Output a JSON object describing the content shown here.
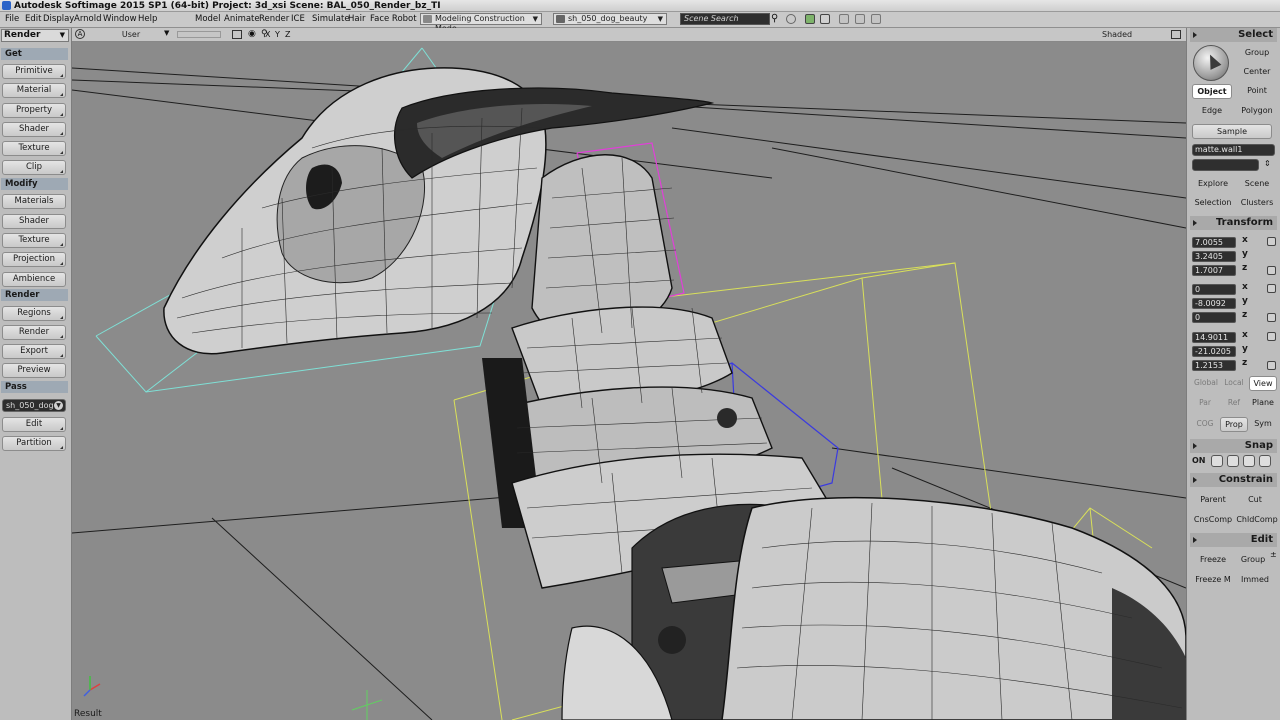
{
  "title": "Autodesk Softimage 2015 SP1 (64-bit)    Project: 3d_xsi    Scene: BAL_050_Render_bz_TI",
  "menus": [
    "File",
    "Edit",
    "Display",
    "Arnold",
    "Window",
    "Help",
    "Model",
    "Animate",
    "Render",
    "ICE",
    "Simulate",
    "Hair",
    "Face Robot"
  ],
  "mode_combo": "Modeling Construction Mode",
  "pass_combo": "sh_050_dog_beauty",
  "search_placeholder": "Scene Search",
  "left": {
    "render_mode": "Render",
    "sections": {
      "get": "Get",
      "modify": "Modify",
      "render": "Render",
      "pass": "Pass"
    },
    "get_buttons": [
      "Primitive",
      "Material",
      "Property",
      "Shader",
      "Texture",
      "Clip"
    ],
    "modify_buttons": [
      "Materials",
      "Shader",
      "Texture",
      "Projection",
      "Ambience"
    ],
    "render_buttons": [
      "Regions",
      "Render",
      "Export",
      "Preview"
    ],
    "pass_field": "sh_050_dog",
    "pass_buttons": [
      "Edit",
      "Partition"
    ]
  },
  "viewport": {
    "camera": "User",
    "axes": [
      "X",
      "Y",
      "Z"
    ],
    "shading": "Shaded",
    "status": "Result"
  },
  "right": {
    "select_head": "Select",
    "group": "Group",
    "center": "Center",
    "object": "Object",
    "point": "Point",
    "edge": "Edge",
    "polygon": "Polygon",
    "sample": "Sample",
    "selection_name": "matte.wall1",
    "explore": "Explore",
    "scene": "Scene",
    "selection": "Selection",
    "clusters": "Clusters",
    "transform_head": "Transform",
    "scale": [
      "7.0055",
      "3.2405",
      "1.7007"
    ],
    "rotate": [
      "0",
      "-8.0092",
      "0"
    ],
    "translate": [
      "14.9011",
      "-21.0205",
      "1.2153"
    ],
    "axis_labels": [
      "x",
      "y",
      "z"
    ],
    "global": "Global",
    "local": "Local",
    "view": "View",
    "par": "Par",
    "ref": "Ref",
    "plane": "Plane",
    "cog": "COG",
    "prop": "Prop",
    "sym": "Sym",
    "snap_head": "Snap",
    "snap_on": "ON",
    "constrain_head": "Constrain",
    "parent": "Parent",
    "cut": "Cut",
    "cnscomp": "CnsComp",
    "chldcomp": "ChldComp",
    "edit_head": "Edit",
    "freeze": "Freeze",
    "group2": "Group",
    "freeze_m": "Freeze M",
    "immed": "Immed"
  }
}
